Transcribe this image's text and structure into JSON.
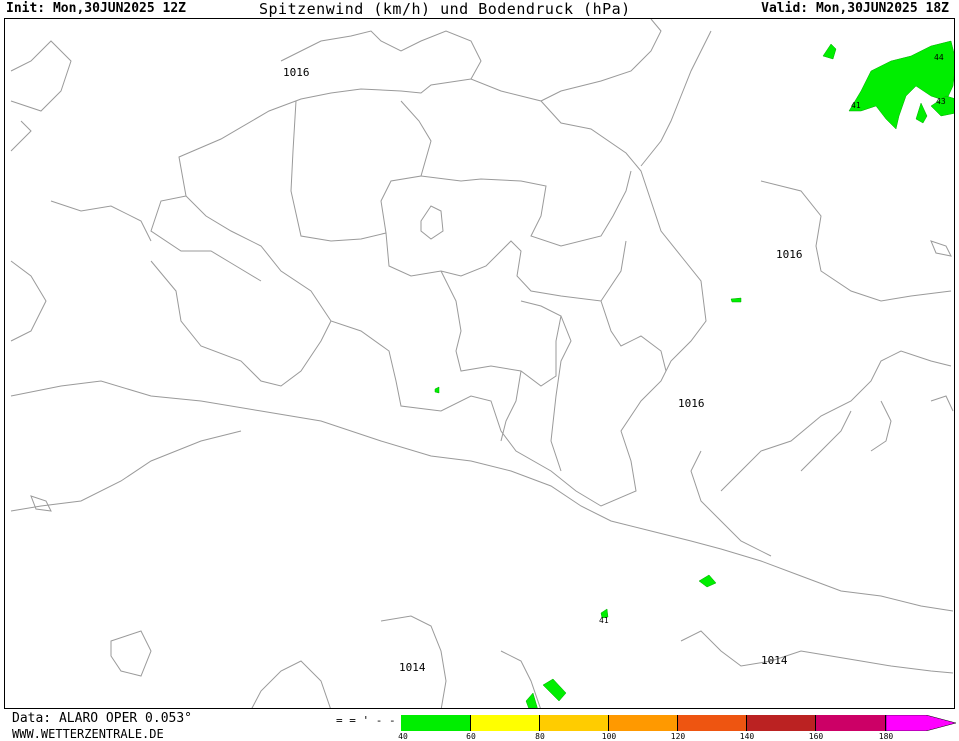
{
  "header": {
    "init": "Init: Mon,30JUN2025 12Z",
    "title": "Spitzenwind (km/h) und Bodendruck (hPa)",
    "valid": "Valid: Mon,30JUN2025 18Z"
  },
  "map": {
    "isobar_labels": [
      "1016",
      "1016",
      "1016",
      "1014",
      "1014"
    ],
    "wind_labels": [
      "44",
      "41",
      "43",
      "41"
    ]
  },
  "footer": {
    "data_source": "Data: ALARO OPER 0.053°",
    "website": "WWW.WETTERZENTRALE.DE"
  },
  "legend": {
    "ticks": [
      "40",
      "60",
      "80",
      "100",
      "120",
      "140",
      "160",
      "180"
    ],
    "colors": [
      "#00ee00",
      "#ffff00",
      "#ffcc00",
      "#ff9900",
      "#ee5511",
      "#bb2222",
      "#cc0066",
      "#ff00ff"
    ]
  }
}
